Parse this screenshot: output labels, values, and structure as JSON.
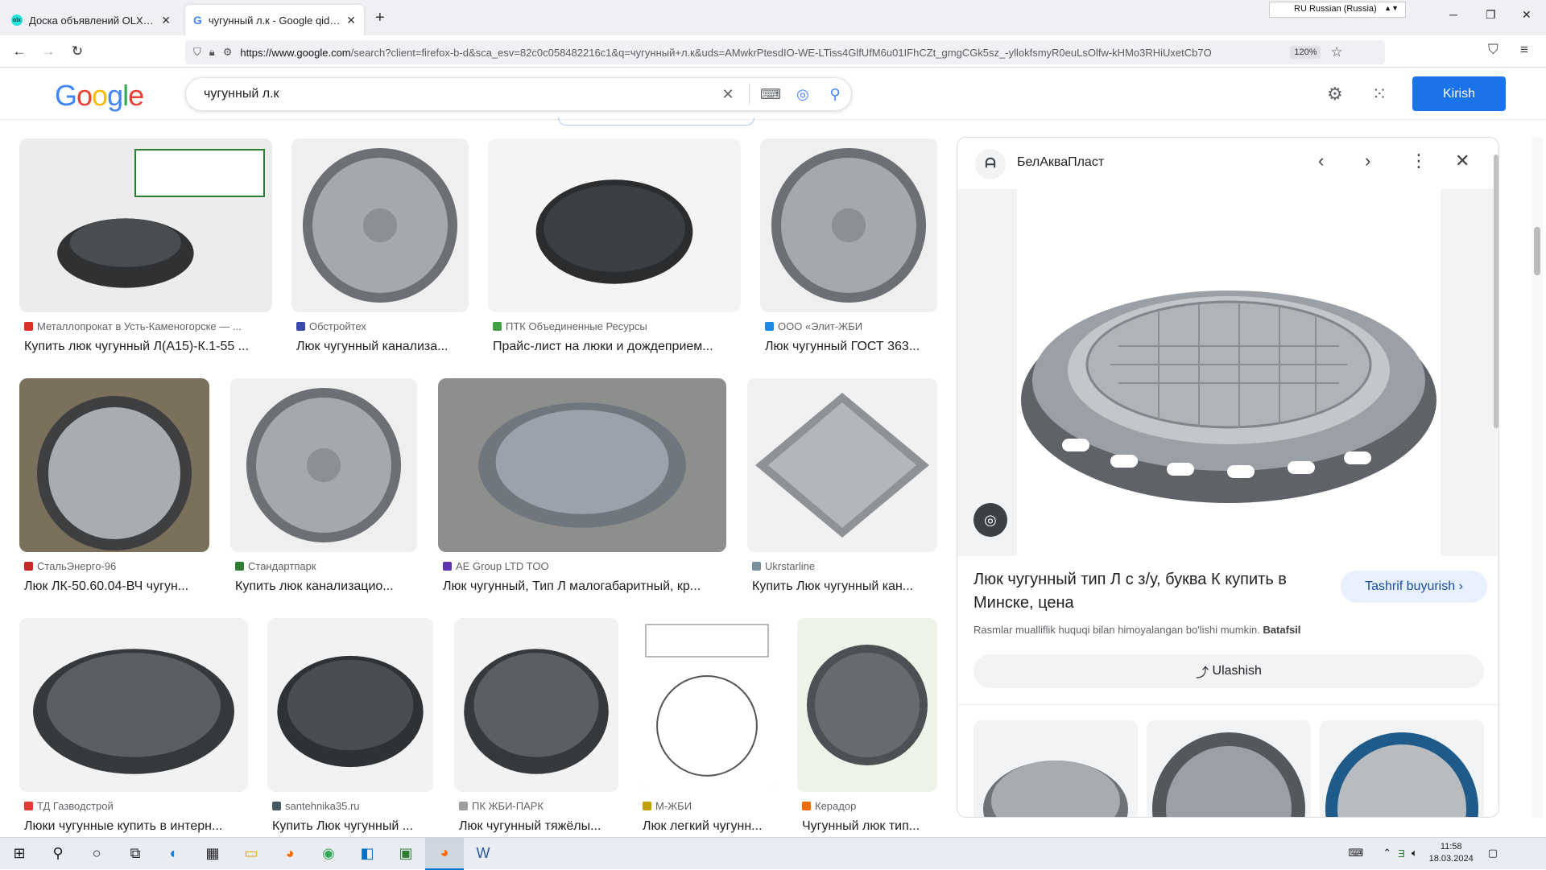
{
  "browser": {
    "tabs": [
      {
        "title": "Доска объявлений OLX.uz, ра",
        "favicon": "olx-favicon"
      },
      {
        "title": "чугунный л.к - Google qidiruvi",
        "favicon": "google-favicon",
        "active": true
      }
    ],
    "language_indicator": "RU Russian (Russia)",
    "url_host": "https://www.google.com",
    "url_rest": "/search?client=firefox-b-d&sca_esv=82c0c058482216c1&q=чугунный+л.к&uds=AMwkrPtesdIO-WE-LTiss4GlfUfM6u01IFhCZt_gmgCGk5sz_-yllokfsmyR0euLsOlfw-kHMo3RHiUxetCb7O",
    "zoom": "120%"
  },
  "google": {
    "logo": "Google",
    "query": "чугунный л.к",
    "sign_in": "Kirish"
  },
  "results": [
    {
      "source": "Металлопрокат в Усть-Каменогорске — ...",
      "title": "Купить люк чугунный Л(А15)-К.1-55 ...",
      "fav_color": "#d93025"
    },
    {
      "source": "Обстройтех",
      "title": "Люк чугунный канализа...",
      "fav_color": "#3949ab"
    },
    {
      "source": "ПТК Объединенные Ресурсы",
      "title": "Прайс-лист на люки и дождеприем...",
      "fav_color": "#43a047"
    },
    {
      "source": "ООО «Элит-ЖБИ",
      "title": "Люк чугунный ГОСТ 363...",
      "fav_color": "#1e88e5"
    },
    {
      "source": "СтальЭнерго-96",
      "title": "Люк ЛК-50.60.04-ВЧ чугун...",
      "fav_color": "#c62828"
    },
    {
      "source": "Стандартпарк",
      "title": "Купить люк канализацио...",
      "fav_color": "#2e7d32"
    },
    {
      "source": "AE Group LTD TOO",
      "title": "Люк чугунный, Тип Л малогабаритный, кр...",
      "fav_color": "#5e35b1"
    },
    {
      "source": "Ukrstarline",
      "title": "Купить Люк чугунный кан...",
      "fav_color": "#78909c"
    },
    {
      "source": "ТД Газводстрой",
      "title": "Люки чугунные купить в интерн...",
      "fav_color": "#e53935"
    },
    {
      "source": "santehnika35.ru",
      "title": "Купить Люк чугунный ...",
      "fav_color": "#455a64"
    },
    {
      "source": "ПК ЖБИ-ПАРК",
      "title": "Люк чугунный тяжёлы...",
      "fav_color": "#9e9e9e"
    },
    {
      "source": "М-ЖБИ",
      "title": "Люк легкий чугунн...",
      "fav_color": "#c0a000"
    },
    {
      "source": "Керадор",
      "title": "Чугунный люк тип...",
      "fav_color": "#ef6c00"
    }
  ],
  "panel": {
    "source": "БелАкваПласт",
    "title": "Люк чугунный тип Л с з/у, буква К купить в Минске, цена",
    "visit": "Tashrif buyurish",
    "copyright": "Rasmlar mualliflik huquqi bilan himoyalangan bo'lishi mumkin.",
    "learn_more": "Batafsil",
    "share": "Ulashish"
  },
  "taskbar": {
    "time": "11:58",
    "date": "18.03.2024"
  }
}
